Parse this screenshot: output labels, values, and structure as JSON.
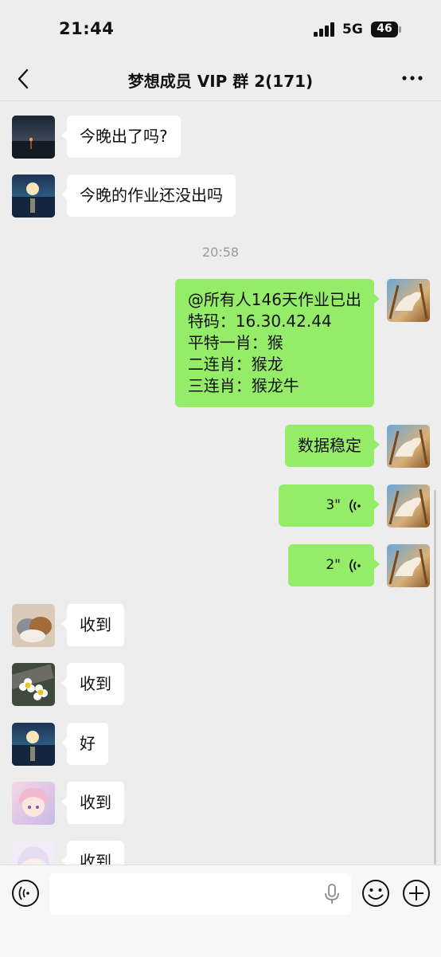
{
  "status_bar": {
    "time": "21:44",
    "network": "5G",
    "battery": "46"
  },
  "nav": {
    "back_icon": "chevron-left-icon",
    "title": "梦想成员 VIP 群 2(171)",
    "more_icon": "more-dots-icon"
  },
  "messages": [
    {
      "text": "今晚出了吗?"
    },
    {
      "text": "今晚的作业还没出吗"
    },
    {
      "timestamp": "20:58"
    },
    {
      "lines": [
        "@所有人146天作业已出",
        "特码：16.30.42.44",
        "平特一肖：猴",
        "二连肖：猴龙",
        "三连肖：猴龙牛"
      ]
    },
    {
      "text": "数据稳定"
    },
    {
      "duration": "3\""
    },
    {
      "duration": "2\""
    },
    {
      "text": "收到"
    },
    {
      "text": "收到"
    },
    {
      "text": "好"
    },
    {
      "text": "收到"
    },
    {
      "text": "收到"
    }
  ],
  "input_bar": {
    "voice_icon": "voice-mode-icon",
    "mic_icon": "microphone-icon",
    "emoji_icon": "emoji-icon",
    "plus_icon": "plus-icon",
    "placeholder": ""
  },
  "colors": {
    "outgoing_bubble": "#95ec69",
    "incoming_bubble": "#ffffff",
    "background": "#ededed"
  }
}
